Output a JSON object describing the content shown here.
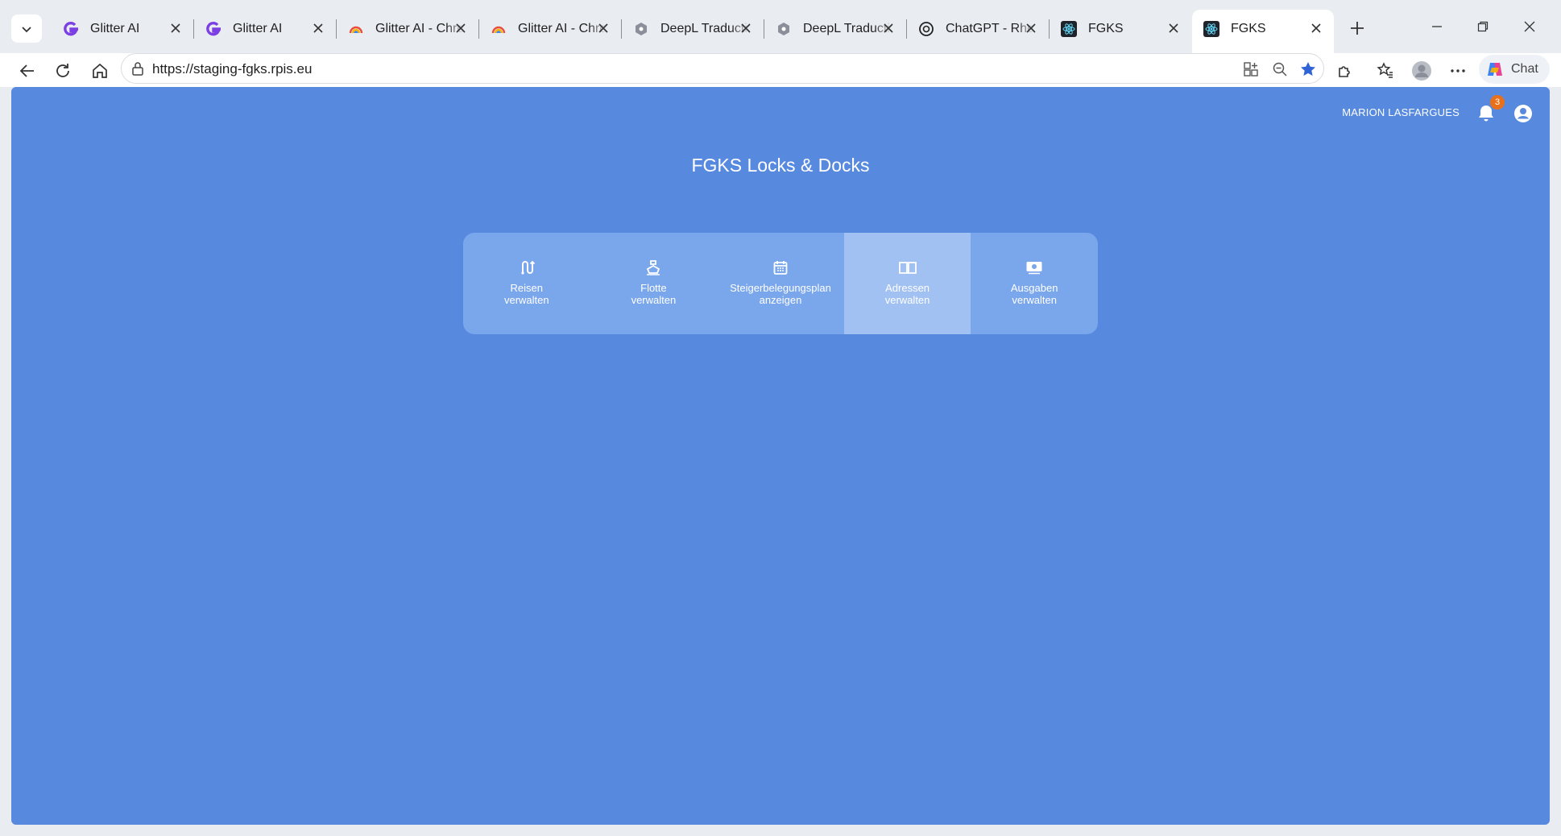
{
  "browser": {
    "tabs": [
      {
        "title": "Glitter AI",
        "icon": "glitter-icon"
      },
      {
        "title": "Glitter AI",
        "icon": "glitter-icon"
      },
      {
        "title": "Glitter AI - Chrome",
        "icon": "rainbow-icon"
      },
      {
        "title": "Glitter AI - Chrome",
        "icon": "rainbow-icon"
      },
      {
        "title": "DeepL Traduction",
        "icon": "deepl-icon"
      },
      {
        "title": "DeepL Traduction",
        "icon": "deepl-icon"
      },
      {
        "title": "ChatGPT - Rheinschiff",
        "icon": "chatgpt-icon"
      },
      {
        "title": "FGKS",
        "icon": "react-icon"
      },
      {
        "title": "FGKS",
        "icon": "react-icon",
        "active": true
      }
    ],
    "url": "https://staging-fgks.rpis.eu",
    "chat_label": "Chat"
  },
  "header": {
    "user_name": "MARION LASFARGUES",
    "notification_count": "3"
  },
  "main": {
    "title": "FGKS Locks & Docks",
    "menu": [
      {
        "label": "Reisen\nverwalten",
        "icon": "route-icon"
      },
      {
        "label": "Flotte\nverwalten",
        "icon": "ship-icon"
      },
      {
        "label": "Steigerbelegungsplan\nanzeigen",
        "icon": "calendar-icon"
      },
      {
        "label": "Adressen\nverwalten",
        "icon": "address-book-icon",
        "hovered": true
      },
      {
        "label": "Ausgaben\nverwalten",
        "icon": "money-icon"
      }
    ]
  },
  "colors": {
    "page_bg": "#5789df",
    "menu_bg": "#7aa6ec",
    "menu_hover": "#a1c1f2",
    "badge": "#e8701a"
  }
}
